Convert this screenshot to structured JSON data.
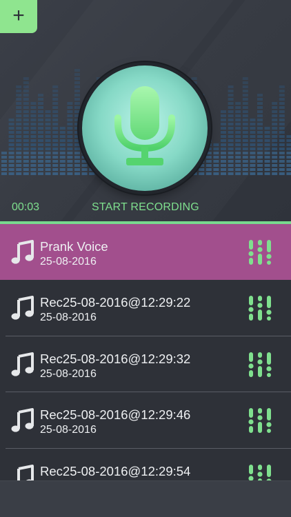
{
  "header": {
    "add_label": "+",
    "timer": "00:03",
    "start_label": "START RECORDING"
  },
  "colors": {
    "accent_green": "#7fe08e",
    "selected_row": "#a24f8d",
    "background": "#2e3138"
  },
  "icons": {
    "add": "plus-icon",
    "record": "microphone-icon",
    "recording_item": "music-note-icon",
    "effects": "equalizer-sliders-icon"
  },
  "recordings": [
    {
      "title": "Prank Voice",
      "date": "25-08-2016",
      "selected": true
    },
    {
      "title": "Rec25-08-2016@12:29:22",
      "date": "25-08-2016",
      "selected": false
    },
    {
      "title": "Rec25-08-2016@12:29:32",
      "date": "25-08-2016",
      "selected": false
    },
    {
      "title": "Rec25-08-2016@12:29:46",
      "date": "25-08-2016",
      "selected": false
    },
    {
      "title": "Rec25-08-2016@12:29:54",
      "date": "",
      "selected": false
    }
  ]
}
